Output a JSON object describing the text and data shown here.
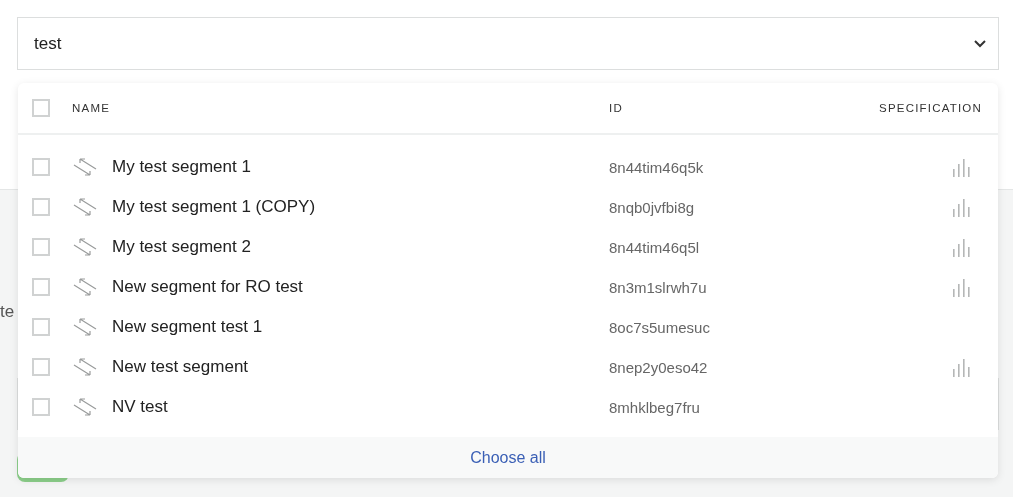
{
  "search": {
    "value": "test"
  },
  "background_label": "te",
  "table": {
    "all_checked": false,
    "columns": [
      "NAME",
      "ID",
      "SPECIFICATION"
    ],
    "rows": [
      {
        "name": "My test segment 1",
        "id": "8n44tim46q5k",
        "checked": false,
        "specification": true
      },
      {
        "name": "My test segment 1 (COPY)",
        "id": "8nqb0jvfbi8g",
        "checked": false,
        "specification": true
      },
      {
        "name": "My test segment 2",
        "id": "8n44tim46q5l",
        "checked": false,
        "specification": true
      },
      {
        "name": "New segment for RO test",
        "id": "8n3m1slrwh7u",
        "checked": false,
        "specification": true
      },
      {
        "name": "New segment test 1",
        "id": "8oc7s5umesuc",
        "checked": false,
        "specification": false
      },
      {
        "name": "New test segment",
        "id": "8nep2y0eso42",
        "checked": false,
        "specification": true
      },
      {
        "name": "NV test",
        "id": "8mhklbeg7fru",
        "checked": false,
        "specification": false
      }
    ]
  },
  "footer": {
    "link": "Choose all"
  }
}
